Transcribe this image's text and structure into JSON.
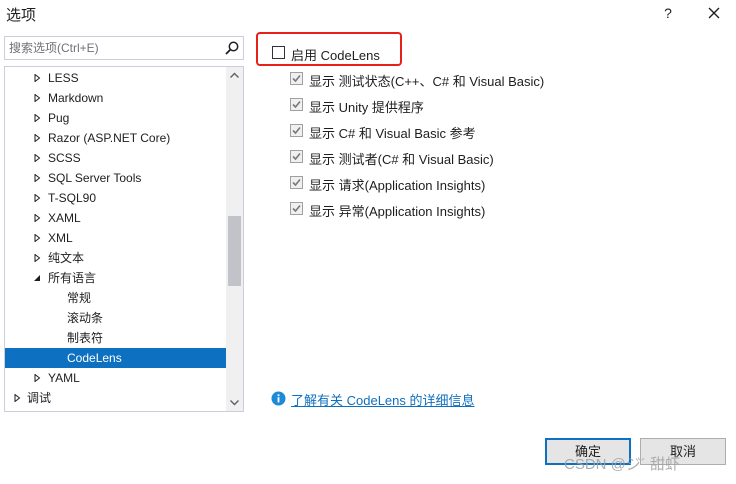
{
  "window": {
    "title": "选项",
    "help_label": "?"
  },
  "search": {
    "placeholder": "搜索选项(Ctrl+E)"
  },
  "tree": {
    "items": [
      {
        "label": "LESS",
        "expandable": true
      },
      {
        "label": "Markdown",
        "expandable": true
      },
      {
        "label": "Pug",
        "expandable": true
      },
      {
        "label": "Razor (ASP.NET Core)",
        "expandable": true
      },
      {
        "label": "SCSS",
        "expandable": true
      },
      {
        "label": "SQL Server Tools",
        "expandable": true
      },
      {
        "label": "T-SQL90",
        "expandable": true
      },
      {
        "label": "XAML",
        "expandable": true
      },
      {
        "label": "XML",
        "expandable": true
      },
      {
        "label": "纯文本",
        "expandable": true
      },
      {
        "label": "所有语言",
        "expanded": true
      },
      {
        "label": "常规"
      },
      {
        "label": "滚动条"
      },
      {
        "label": "制表符"
      },
      {
        "label": "CodeLens",
        "selected": true
      },
      {
        "label": "YAML",
        "expandable": true
      },
      {
        "label": "调试",
        "expandable": true
      }
    ],
    "scroll_position": 0.55
  },
  "codelens": {
    "enable_label": "启用 CodeLens",
    "enabled": false,
    "options": [
      {
        "label": "显示 测试状态(C++、C# 和 Visual Basic)",
        "checked": true,
        "disabled": true
      },
      {
        "label": "显示 Unity 提供程序",
        "checked": true,
        "disabled": true
      },
      {
        "label": "显示 C# 和 Visual Basic 参考",
        "checked": true,
        "disabled": true
      },
      {
        "label": "显示 测试者(C# 和 Visual Basic)",
        "checked": true,
        "disabled": true
      },
      {
        "label": "显示 请求(Application Insights)",
        "checked": true,
        "disabled": true
      },
      {
        "label": "显示 异常(Application Insights)",
        "checked": true,
        "disabled": true
      }
    ],
    "info_link": "了解有关 CodeLens 的详细信息"
  },
  "buttons": {
    "ok_label": "确定",
    "cancel_label": "取消"
  },
  "watermark": "CSDN @ジ´ 甜虾",
  "colors": {
    "selection": "#0e70c0",
    "highlight_border": "#e8201a",
    "link": "#0e70c0"
  }
}
